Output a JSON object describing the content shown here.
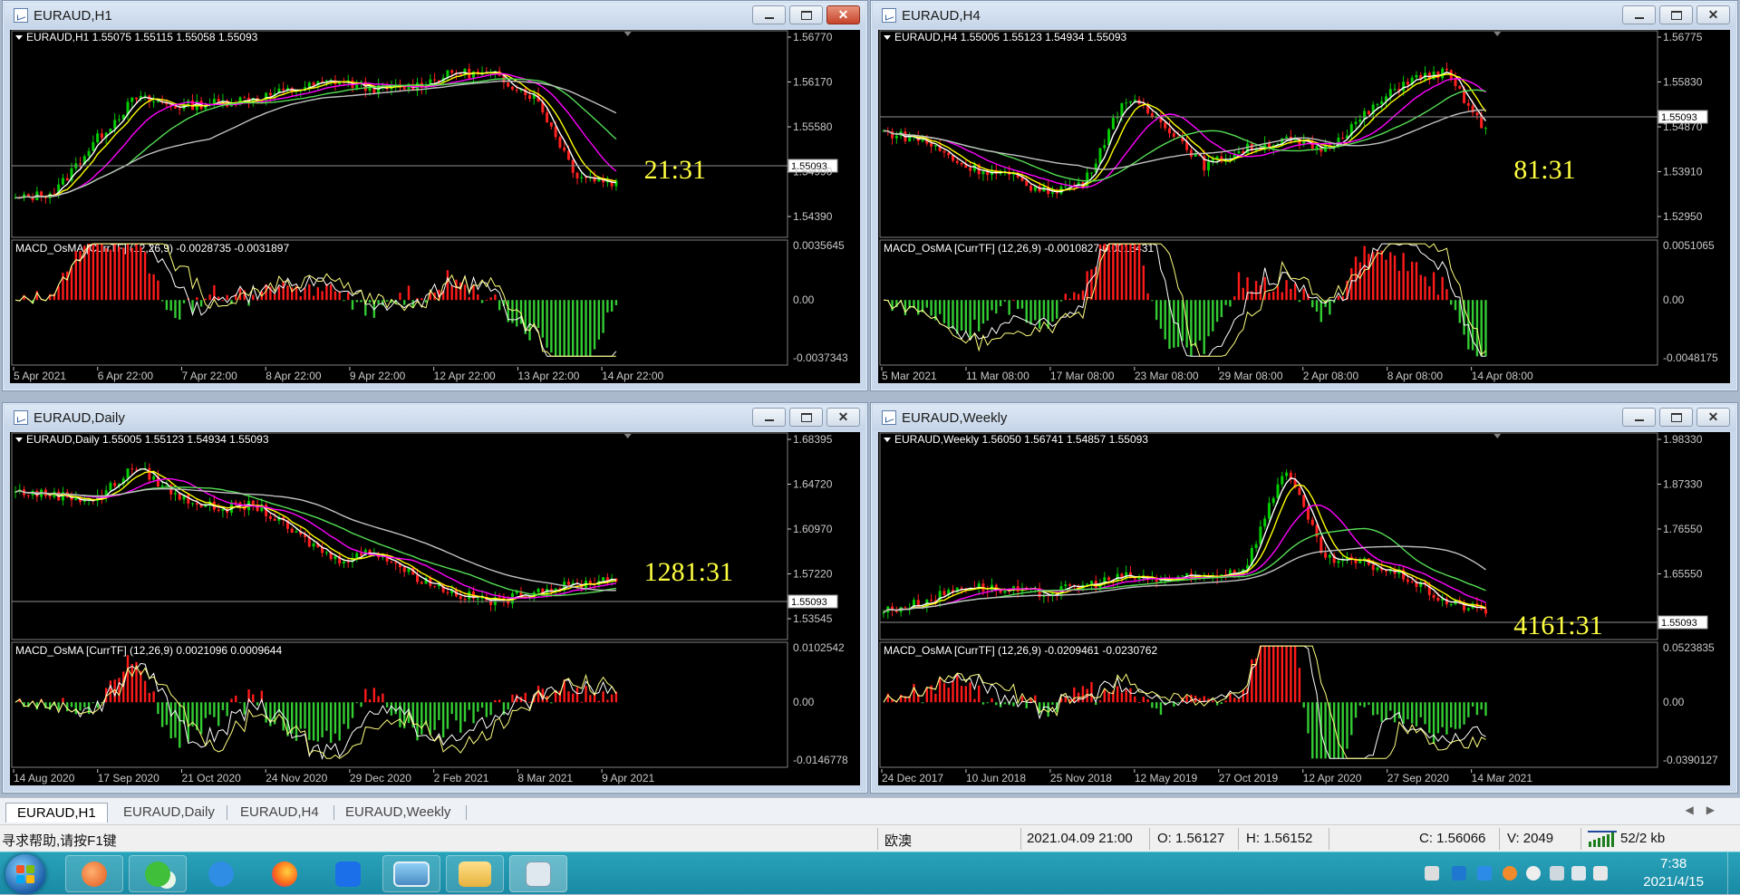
{
  "colors": {
    "ma_white": "#ffffff",
    "ma_yellow": "#ffff00",
    "ma_magenta": "#ff00ff",
    "ma_green": "#55dd55",
    "ma_silver": "#c0c0c0",
    "bull": "#00cc00",
    "bear": "#ff2020",
    "osma_up": "#ff1a1a",
    "osma_down": "#33cc33",
    "countdown": "#ffff40",
    "axis": "#c8c8c8",
    "grid": "#808080"
  },
  "windows": [
    {
      "id": "h1",
      "title": "EURAUD,H1",
      "info": "EURAUD,H1  1.55075 1.55115 1.55058 1.55093",
      "price_labels": [
        "1.56770",
        "1.56170",
        "1.55580",
        "1.54990",
        "1.54390"
      ],
      "current_price": "1.55093",
      "countdown": "21:31",
      "macd_label": "MACD_OsMA [CurrTF] (12,26,9) -0.0028735 -0.0031897",
      "macd_labels": [
        "0.0035645",
        "0.00",
        "-0.0037343"
      ],
      "date_labels": [
        "5 Apr 2021",
        "6 Apr 22:00",
        "7 Apr 22:00",
        "8 Apr 22:00",
        "9 Apr 22:00",
        "12 Apr 22:00",
        "13 Apr 22:00",
        "14 Apr 22:00"
      ]
    },
    {
      "id": "h4",
      "title": "EURAUD,H4",
      "info": "EURAUD,H4  1.55005 1.55123 1.54934 1.55093",
      "price_labels": [
        "1.56775",
        "1.55830",
        "1.54870",
        "1.53910",
        "1.52950"
      ],
      "current_price": "1.55093",
      "countdown": "81:31",
      "macd_label": "MACD_OsMA [CurrTF] (12,26,9) -0.0010827 0.0013431",
      "macd_labels": [
        "0.0051065",
        "0.00",
        "-0.0048175"
      ],
      "date_labels": [
        "5 Mar 2021",
        "11 Mar 08:00",
        "17 Mar 08:00",
        "23 Mar 08:00",
        "29 Mar 08:00",
        "2 Apr 08:00",
        "8 Apr 08:00",
        "14 Apr 08:00"
      ]
    },
    {
      "id": "daily",
      "title": "EURAUD,Daily",
      "info": "EURAUD,Daily  1.55005 1.55123 1.54934 1.55093",
      "price_labels": [
        "1.68395",
        "1.64720",
        "1.60970",
        "1.57220",
        "1.53545"
      ],
      "current_price": "1.55093",
      "countdown": "1281:31",
      "macd_label": "MACD_OsMA [CurrTF] (12,26,9) 0.0021096 0.0009644",
      "macd_labels": [
        "0.0102542",
        "0.00",
        "-0.0146778"
      ],
      "date_labels": [
        "14 Aug 2020",
        "17 Sep 2020",
        "21 Oct 2020",
        "24 Nov 2020",
        "29 Dec 2020",
        "2 Feb 2021",
        "8 Mar 2021",
        "9 Apr 2021"
      ]
    },
    {
      "id": "weekly",
      "title": "EURAUD,Weekly",
      "info": "EURAUD,Weekly  1.56050 1.56741 1.54857 1.55093",
      "price_labels": [
        "1.98330",
        "1.87330",
        "1.76550",
        "1.65550",
        "1.55093"
      ],
      "current_price": "1.55093",
      "countdown": "4161:31",
      "macd_label": "MACD_OsMA [CurrTF] (12,26,9) -0.0209461 -0.0230762",
      "macd_labels": [
        "0.0523835",
        "0.00",
        "-0.0390127"
      ],
      "date_labels": [
        "24 Dec 2017",
        "10 Jun 2018",
        "25 Nov 2018",
        "12 May 2019",
        "27 Oct 2019",
        "12 Apr 2020",
        "27 Sep 2020",
        "14 Mar 2021"
      ]
    }
  ],
  "tabs": [
    "EURAUD,H1",
    "EURAUD,Daily",
    "EURAUD,H4",
    "EURAUD,Weekly"
  ],
  "status": {
    "help": "寻求帮助,请按F1键",
    "profile": "欧澳",
    "datetime": "2021.04.09 21:00",
    "open": "O: 1.56127",
    "high": "H: 1.56152",
    "close": "C: 1.56066",
    "volume": "V: 2049",
    "traffic": "52/2 kb"
  },
  "clock": {
    "time": "7:38",
    "date": "2021/4/15"
  },
  "taskbar_apps": [
    "start-orb",
    "mail-app",
    "wechat-app",
    "pen-app",
    "firefox-app",
    "lark-app",
    "photo-viewer-app",
    "file-explorer-app",
    "metatrader-app"
  ]
}
